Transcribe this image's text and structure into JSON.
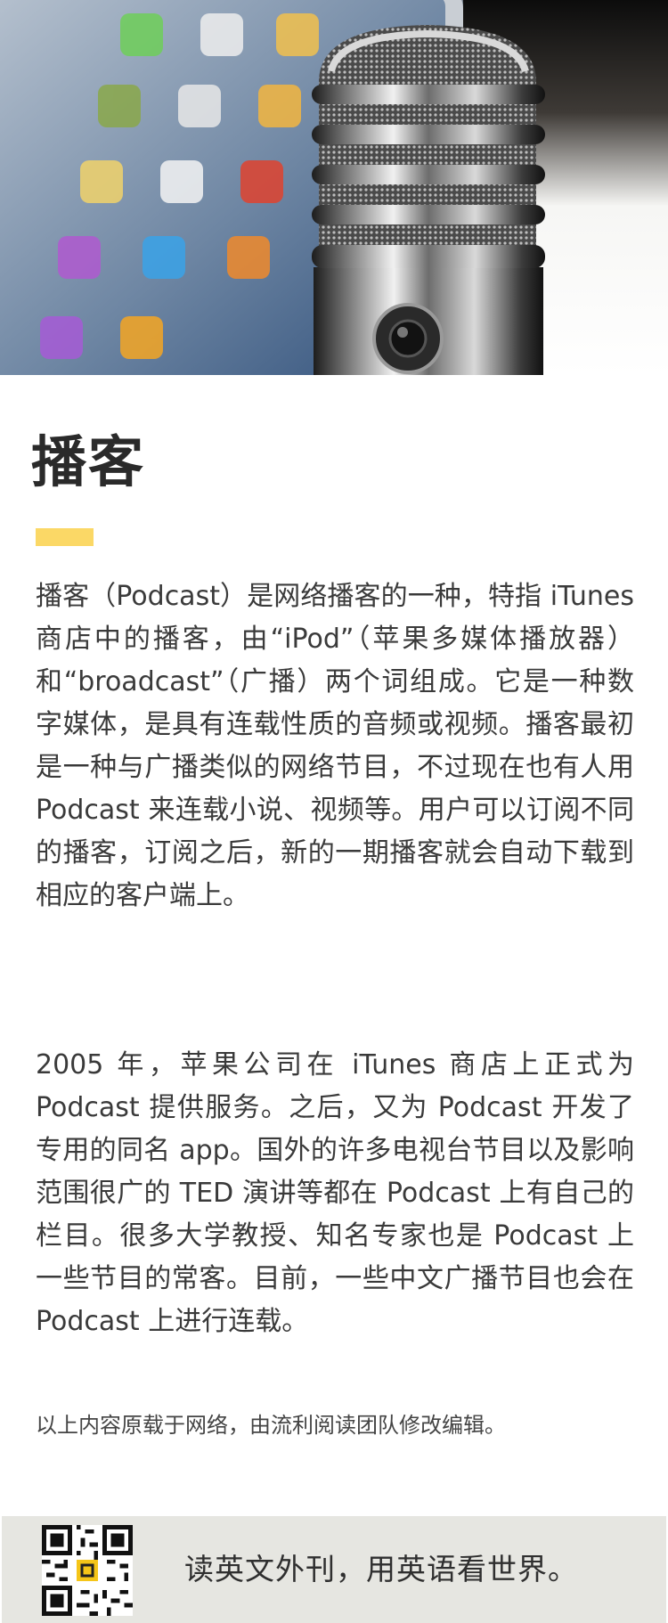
{
  "article": {
    "title": "播客",
    "paragraphs": [
      "播客（Podcast）是网络播客的一种，特指 iTunes 商店中的播客，由“iPod”（苹果多媒体播放器）和“broadcast”（广播）两个词组成。它是一种数字媒体，是具有连载性质的音频或视频。播客最初是一种与广播类似的网络节目，不过现在也有人用 Podcast 来连载小说、视频等。用户可以订阅不同的播客，订阅之后，新的一期播客就会自动下载到相应的客户端上。",
      "2005 年，苹果公司在 iTunes 商店上正式为 Podcast 提供服务。之后，又为 Podcast 开发了专用的同名 app。国外的许多电视台节目以及影响范围很广的 TED 演讲等都在 Podcast 上有自己的栏目。很多大学教授、知名专家也是 Podcast 上一些节目的常客。目前，一些中文广播节目也会在 Podcast 上进行连载。"
    ],
    "source_note": "以上内容原载于网络，由流利阅读团队修改编辑。"
  },
  "footer": {
    "slogan": "读英文外刊，用英语看世界。"
  },
  "colors": {
    "accent": "#fbd866",
    "footer_bg": "#e6e6e1",
    "text": "#3a3a3a"
  }
}
